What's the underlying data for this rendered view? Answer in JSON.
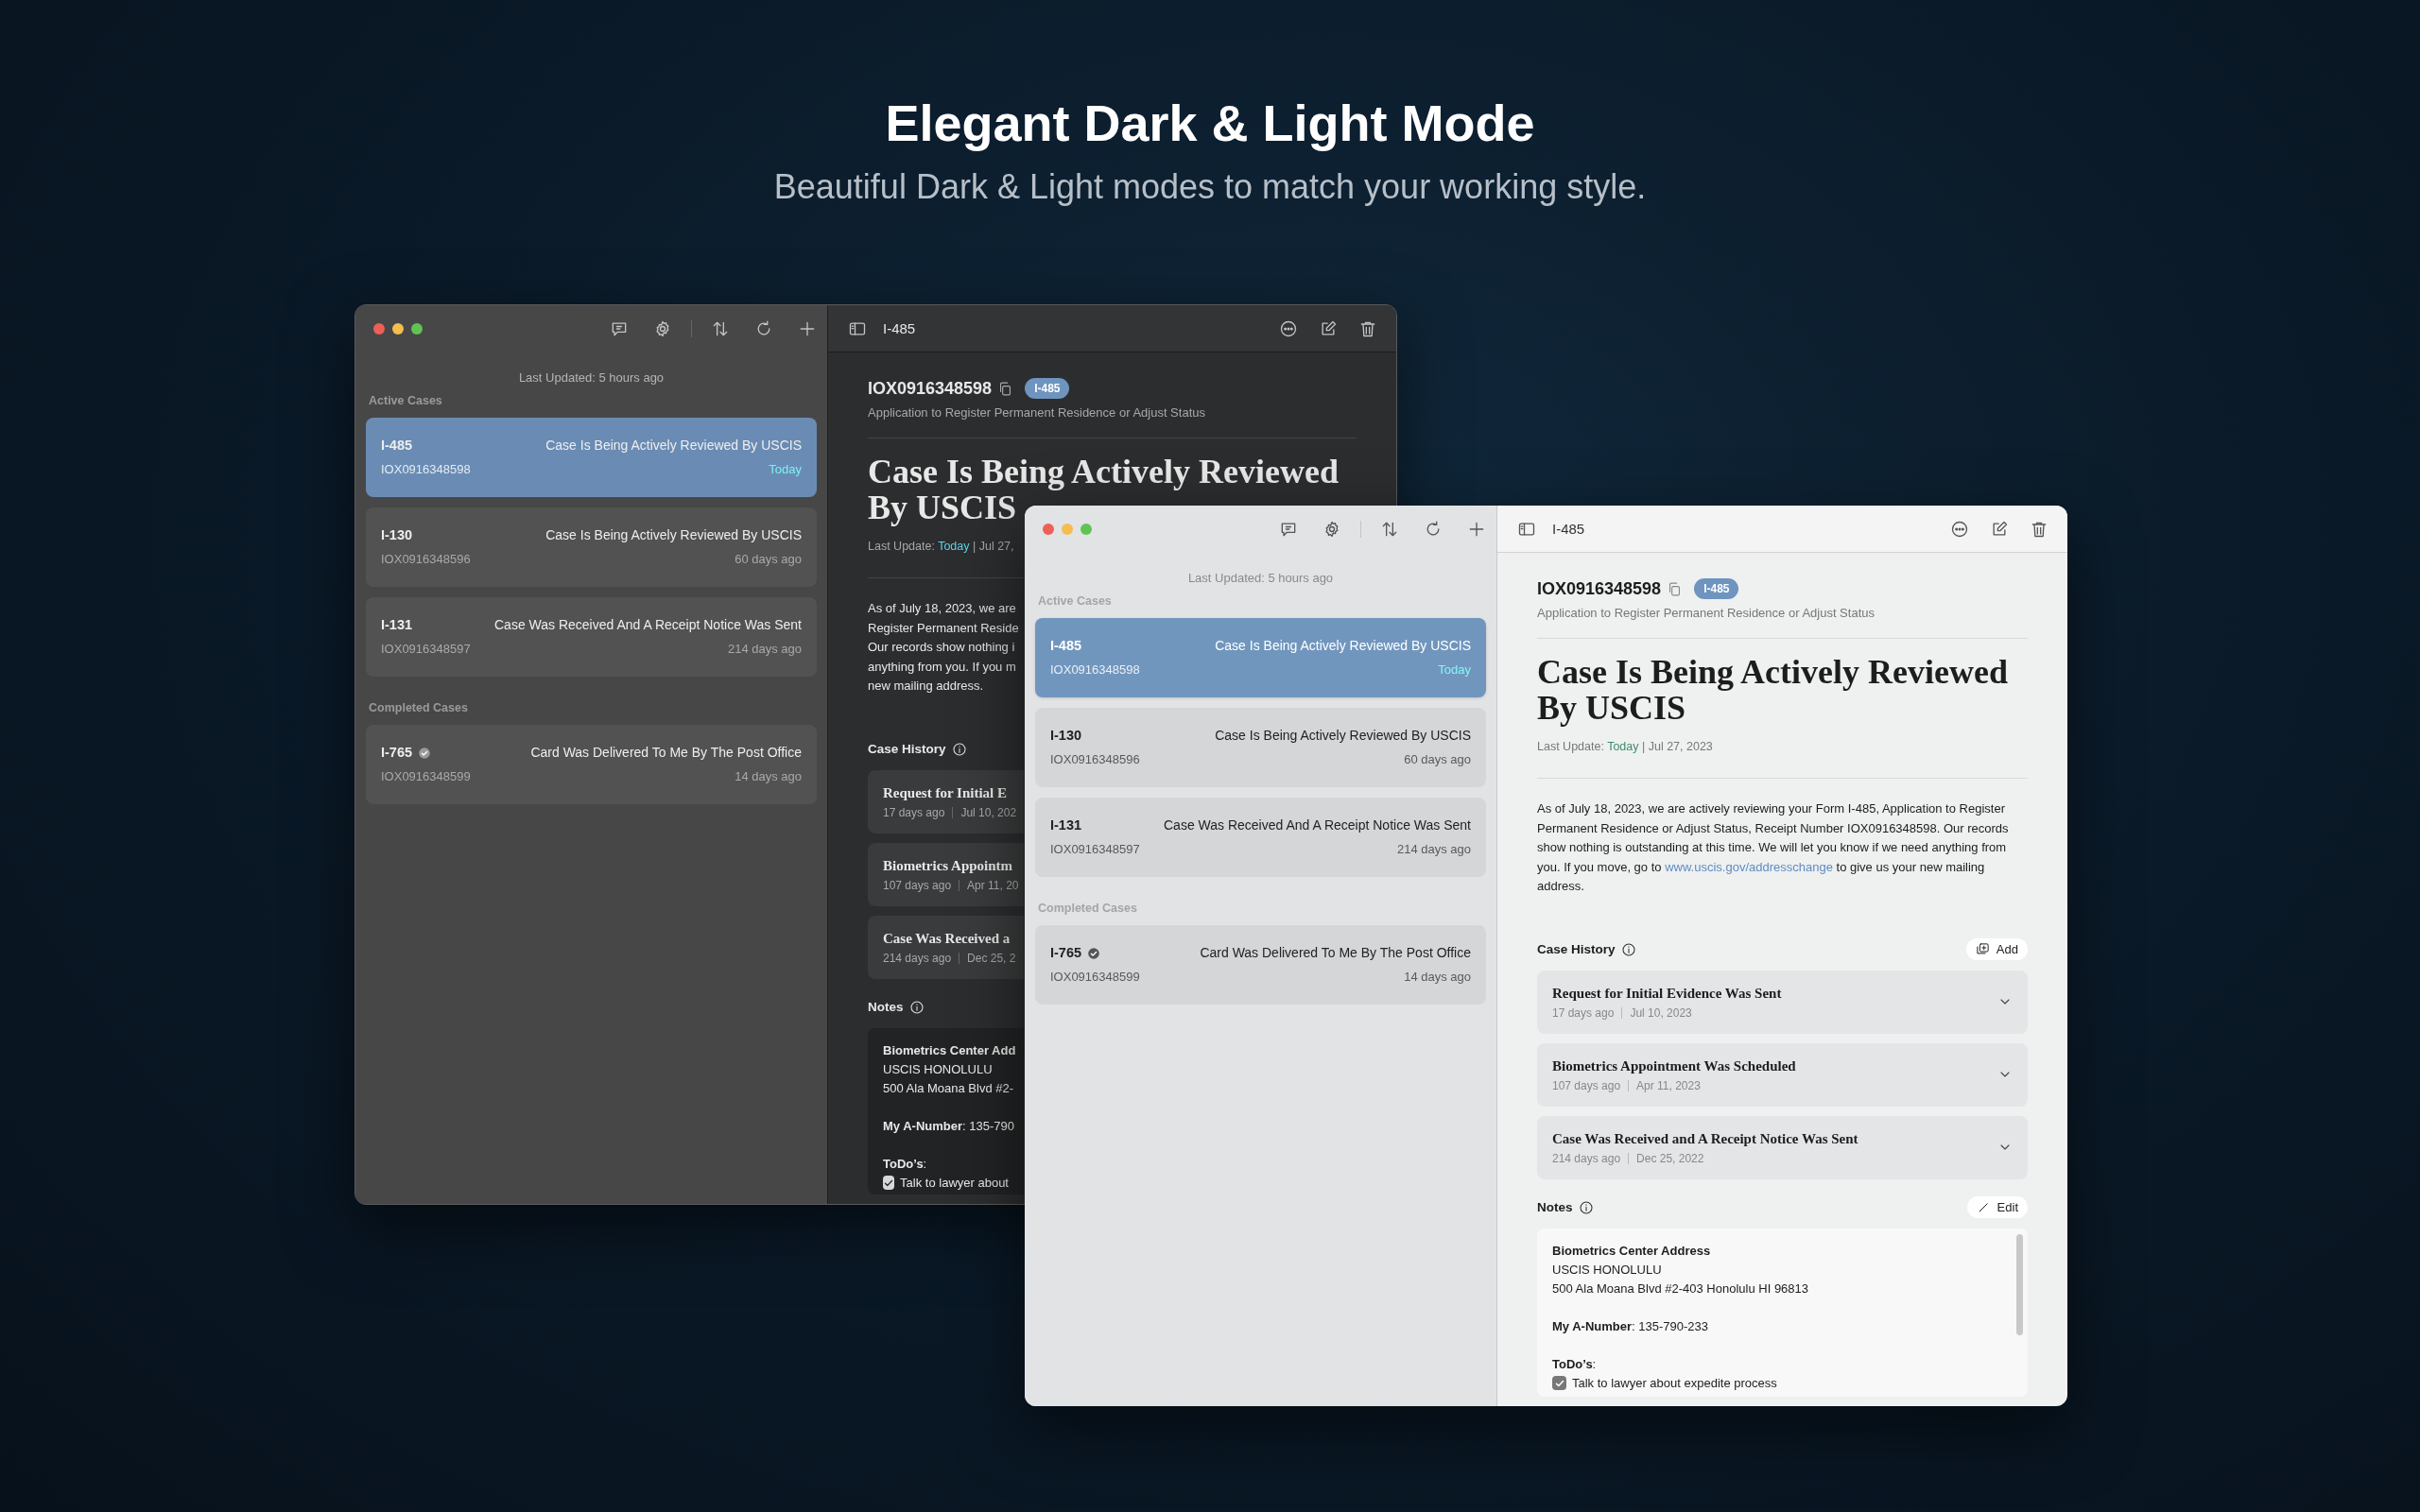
{
  "hero": {
    "title": "Elegant Dark & Light Mode",
    "subtitle": "Beautiful Dark & Light modes to match your working style."
  },
  "windows": [
    {
      "kind": "dark",
      "sidebar": {
        "last_updated": "Last Updated: 5 hours ago",
        "sections": [
          {
            "title": "Active Cases",
            "cases": [
              {
                "form": "I-485",
                "verified": false,
                "status": "Case Is Being Actively Reviewed By USCIS",
                "receipt": "IOX0916348598",
                "age": "Today",
                "updated_today": true,
                "selected": true
              },
              {
                "form": "I-130",
                "verified": false,
                "status": "Case Is Being Actively Reviewed By USCIS",
                "receipt": "IOX0916348596",
                "age": "60 days ago",
                "updated_today": false,
                "selected": false
              },
              {
                "form": "I-131",
                "verified": false,
                "status": "Case Was Received And A Receipt Notice Was Sent",
                "receipt": "IOX0916348597",
                "age": "214 days ago",
                "updated_today": false,
                "selected": false
              }
            ]
          },
          {
            "title": "Completed Cases",
            "cases": [
              {
                "form": "I-765",
                "verified": true,
                "status": "Card Was Delivered To Me By The Post Office",
                "receipt": "IOX0916348599",
                "age": "14 days ago",
                "updated_today": false,
                "selected": false
              }
            ]
          }
        ]
      },
      "detail": {
        "toolbar_title": "I-485",
        "receipt": "IOX0916348598",
        "badge": "I-485",
        "form_name": "Application to Register Permanent Residence or Adjust Status",
        "status_title": "Case Is Being Actively Reviewed By USCIS",
        "last_update": {
          "label": "Last Update:",
          "when": "Today",
          "rest": "| Jul 27,"
        },
        "body_lines": [
          "As of July 18, 2023, we are",
          "Register Permanent Reside",
          "Our records show nothing i",
          "anything from you. If you m",
          "new mailing address."
        ],
        "history": {
          "title": "Case History",
          "events": [
            {
              "title": "Request for Initial E",
              "age": "17 days ago",
              "date": "Jul 10, 202"
            },
            {
              "title": "Biometrics Appointm",
              "age": "107 days ago",
              "date": "Apr 11, 20"
            },
            {
              "title": "Case Was Received a",
              "age": "214 days ago",
              "date": "Dec 25, 2"
            }
          ]
        },
        "notes": {
          "title": "Notes",
          "blocks": [
            [
              "**Biometrics Center Add**",
              "USCIS HONOLULU",
              "500 Ala Moana Blvd #2-"
            ],
            [
              "**My A-Number**: 135-790"
            ],
            [
              "**ToDo’s**:"
            ]
          ],
          "todos": [
            {
              "text": "Talk to lawyer about",
              "checked": true
            }
          ]
        }
      }
    },
    {
      "kind": "light",
      "sidebar": {
        "last_updated": "Last Updated: 5 hours ago",
        "sections": [
          {
            "title": "Active Cases",
            "cases": [
              {
                "form": "I-485",
                "verified": false,
                "status": "Case Is Being Actively Reviewed By USCIS",
                "receipt": "IOX0916348598",
                "age": "Today",
                "updated_today": true,
                "selected": true
              },
              {
                "form": "I-130",
                "verified": false,
                "status": "Case Is Being Actively Reviewed By USCIS",
                "receipt": "IOX0916348596",
                "age": "60 days ago",
                "updated_today": false,
                "selected": false
              },
              {
                "form": "I-131",
                "verified": false,
                "status": "Case Was Received And A Receipt Notice Was Sent",
                "receipt": "IOX0916348597",
                "age": "214 days ago",
                "updated_today": false,
                "selected": false
              }
            ]
          },
          {
            "title": "Completed Cases",
            "cases": [
              {
                "form": "I-765",
                "verified": true,
                "status": "Card Was Delivered To Me By The Post Office",
                "receipt": "IOX0916348599",
                "age": "14 days ago",
                "updated_today": false,
                "selected": false
              }
            ]
          }
        ]
      },
      "detail": {
        "toolbar_title": "I-485",
        "receipt": "IOX0916348598",
        "badge": "I-485",
        "form_name": "Application to Register Permanent Residence or Adjust Status",
        "status_title": "Case Is Being Actively Reviewed By USCIS",
        "last_update": {
          "label": "Last Update:",
          "when": "Today",
          "rest": "| Jul 27, 2023"
        },
        "body": {
          "before": "As of July 18, 2023, we are actively reviewing your Form I-485, Application to Register Permanent Residence or Adjust Status, Receipt Number IOX0916348598. Our records show nothing is outstanding at this time. We will let you know if we need anything from you. If you move, go to ",
          "link": "www.uscis.gov/addresschange",
          "after": " to give us your new mailing address."
        },
        "history": {
          "title": "Case History",
          "add_button": "Add",
          "events": [
            {
              "title": "Request for Initial Evidence Was Sent",
              "age": "17 days ago",
              "date": "Jul 10, 2023",
              "expanded": false
            },
            {
              "title": "Biometrics Appointment Was Scheduled",
              "age": "107 days ago",
              "date": "Apr 11, 2023",
              "expanded": false
            },
            {
              "title": "Case Was Received and A Receipt Notice Was Sent",
              "age": "214 days ago",
              "date": "Dec 25, 2022",
              "expanded": false
            }
          ]
        },
        "notes": {
          "title": "Notes",
          "edit_button": "Edit",
          "blocks": [
            [
              "**Biometrics Center Address**",
              "USCIS HONOLULU",
              "500 Ala Moana Blvd #2-403 Honolulu HI 96813"
            ],
            [
              "**My A-Number**: 135-790-233"
            ],
            [
              "**ToDo’s**:"
            ]
          ],
          "todos": [
            {
              "text": "Talk to lawyer about expedite process",
              "checked": true
            }
          ]
        }
      }
    }
  ]
}
